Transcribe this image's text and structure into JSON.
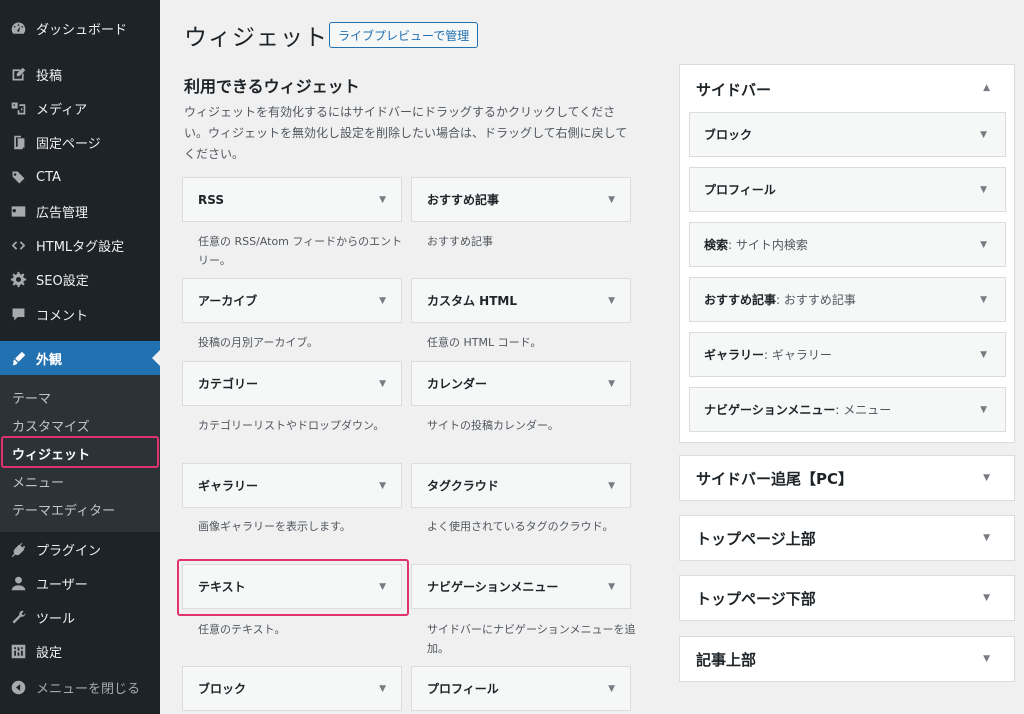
{
  "admin_menu": {
    "items": [
      {
        "label": "ダッシュボード",
        "icon": "dashboard-icon"
      },
      {
        "label": "投稿",
        "icon": "post-icon"
      },
      {
        "label": "メディア",
        "icon": "media-icon"
      },
      {
        "label": "固定ページ",
        "icon": "page-icon"
      },
      {
        "label": "CTA",
        "icon": "cta-icon"
      },
      {
        "label": "広告管理",
        "icon": "ad-icon"
      },
      {
        "label": "HTMLタグ設定",
        "icon": "code-icon"
      },
      {
        "label": "SEO設定",
        "icon": "gear-icon"
      },
      {
        "label": "コメント",
        "icon": "comment-icon"
      },
      {
        "label": "外観",
        "icon": "appearance-icon"
      },
      {
        "label": "プラグイン",
        "icon": "plugin-icon"
      },
      {
        "label": "ユーザー",
        "icon": "user-icon"
      },
      {
        "label": "ツール",
        "icon": "tool-icon"
      },
      {
        "label": "設定",
        "icon": "settings-icon"
      },
      {
        "label": "メニューを閉じる",
        "icon": "collapse-icon"
      }
    ],
    "submenu": [
      "テーマ",
      "カスタマイズ",
      "ウィジェット",
      "メニュー",
      "テーマエディター"
    ]
  },
  "header": {
    "title": "ウィジェット",
    "live_preview_label": "ライブプレビューで管理"
  },
  "available": {
    "heading": "利用できるウィジェット",
    "description": "ウィジェットを有効化するにはサイドバーにドラッグするかクリックしてください。ウィジェットを無効化し設定を削除したい場合は、ドラッグして右側に戻してください。",
    "widgets": [
      {
        "title": "RSS",
        "desc": "任意の RSS/Atom フィードからのエントリー。"
      },
      {
        "title": "おすすめ記事",
        "desc": "おすすめ記事"
      },
      {
        "title": "アーカイブ",
        "desc": "投稿の月別アーカイブ。"
      },
      {
        "title": "カスタム HTML",
        "desc": "任意の HTML コード。"
      },
      {
        "title": "カテゴリー",
        "desc": "カテゴリーリストやドロップダウン。"
      },
      {
        "title": "カレンダー",
        "desc": "サイトの投稿カレンダー。"
      },
      {
        "title": "ギャラリー",
        "desc": "画像ギャラリーを表示します。"
      },
      {
        "title": "タグクラウド",
        "desc": "よく使用されているタグのクラウド。"
      },
      {
        "title": "テキスト",
        "desc": "任意のテキスト。"
      },
      {
        "title": "ナビゲーションメニュー",
        "desc": "サイドバーにナビゲーションメニューを追加。"
      },
      {
        "title": "ブロック",
        "desc": ""
      },
      {
        "title": "プロフィール",
        "desc": ""
      }
    ]
  },
  "sidebar_area": {
    "title": "サイドバー",
    "widgets": [
      {
        "name": "ブロック",
        "sub": ""
      },
      {
        "name": "プロフィール",
        "sub": ""
      },
      {
        "name": "検索",
        "sub": ": サイト内検索"
      },
      {
        "name": "おすすめ記事",
        "sub": ": おすすめ記事"
      },
      {
        "name": "ギャラリー",
        "sub": ": ギャラリー"
      },
      {
        "name": "ナビゲーションメニュー",
        "sub": ": メニュー"
      }
    ]
  },
  "other_areas": [
    "サイドバー追尾【PC】",
    "トップページ上部",
    "トップページ下部",
    "記事上部"
  ],
  "colors": {
    "accent": "#2271b1",
    "highlight": "#e0336e",
    "menu_bg": "#1d2327"
  }
}
